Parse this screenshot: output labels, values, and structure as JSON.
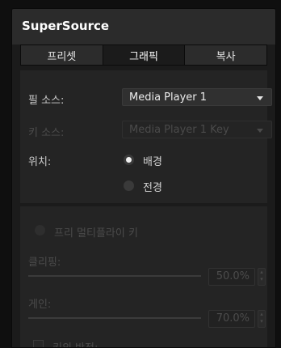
{
  "panel": {
    "title": "SuperSource"
  },
  "tabs": [
    {
      "label": "프리셋",
      "active": false
    },
    {
      "label": "그래픽",
      "active": true
    },
    {
      "label": "복사",
      "active": false
    }
  ],
  "fill_source": {
    "label": "필 소스:",
    "value": "Media Player 1"
  },
  "key_source": {
    "label": "키 소스:",
    "value": "Media Player 1 Key",
    "enabled": false
  },
  "position": {
    "label": "위치:",
    "options": [
      {
        "label": "배경",
        "selected": true
      },
      {
        "label": "전경",
        "selected": false
      }
    ]
  },
  "premultiplied_key": {
    "label": "프리 멀티플라이 키",
    "enabled": false
  },
  "clip": {
    "label": "클리핑:",
    "value": "50.0%"
  },
  "gain": {
    "label": "게인:",
    "value": "70.0%"
  },
  "invert_key": {
    "label": "키의 반전:"
  },
  "colors": {
    "panel_bg": "#1b1b1b",
    "header_bg": "#2b2b2b",
    "section_bg": "#242424"
  }
}
